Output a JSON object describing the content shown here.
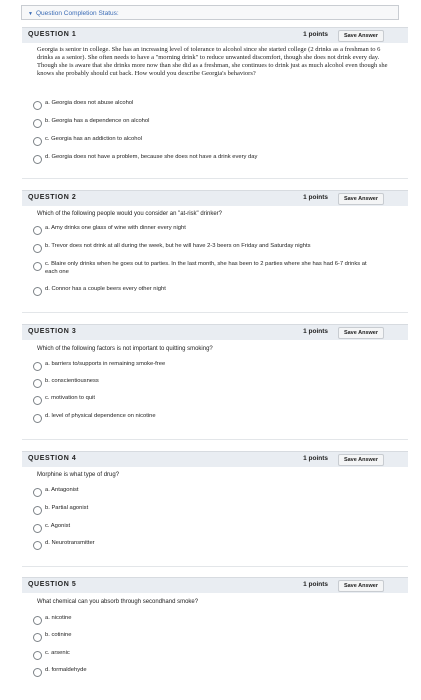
{
  "status_bar": {
    "label": "Question Completion Status:"
  },
  "questions": [
    {
      "title": "QUESTION 1",
      "points": "1 points",
      "save": "Save Answer",
      "text": "Georgia is senior in college. She has an increasing level of tolerance to alcohol since she started college (2 drinks as a freshman to 6 drinks as a senior). She often needs to have a \"morning drink\" to reduce unwanted discomfort, though she does not drink every day. Though she is aware that she drinks more now than she did as a freshman, she continues to drink just as much alcohol even though she knows she probably should cut back. How would you describe Georgia's behaviors?",
      "options": [
        "a. Georgia does not abuse alcohol",
        "b. Georgia has a dependence on alcohol",
        "c. Georgia has an addiction to alcohol",
        "d. Georgia does not have a problem, because she does not have a drink every day"
      ]
    },
    {
      "title": "QUESTION 2",
      "points": "1 points",
      "save": "Save Answer",
      "text": "Which of the following people would you consider an \"at-risk\" drinker?",
      "options": [
        "a. Amy drinks one glass of wine with dinner every night",
        "b. Trevor does not drink at all during the week, but he will have 2-3 beers on Friday and Saturday nights",
        "c. Blaire only drinks when he goes out to parties. In the last month, she has been to 2 parties where she has had 6-7 drinks at each one",
        "d. Connor has a couple beers every other night"
      ]
    },
    {
      "title": "QUESTION 3",
      "points": "1 points",
      "save": "Save Answer",
      "text": "Which of the following factors is not important to quitting smoking?",
      "options": [
        "a. barriers to/supports in remaining smoke-free",
        "b. conscientiousness",
        "c. motivation to quit",
        "d. level of physical dependence on nicotine"
      ]
    },
    {
      "title": "QUESTION 4",
      "points": "1 points",
      "save": "Save Answer",
      "text": "Morphine is what type of drug?",
      "options": [
        "a. Antagonist",
        "b. Partial agonist",
        "c. Agonist",
        "d. Neurotransmitter"
      ]
    },
    {
      "title": "QUESTION 5",
      "points": "1 points",
      "save": "Save Answer",
      "text": "What chemical can you absorb through secondhand smoke?",
      "options": [
        "a. nicotine",
        "b. cotinine",
        "c. arsenic",
        "d. formaldehyde"
      ]
    }
  ]
}
